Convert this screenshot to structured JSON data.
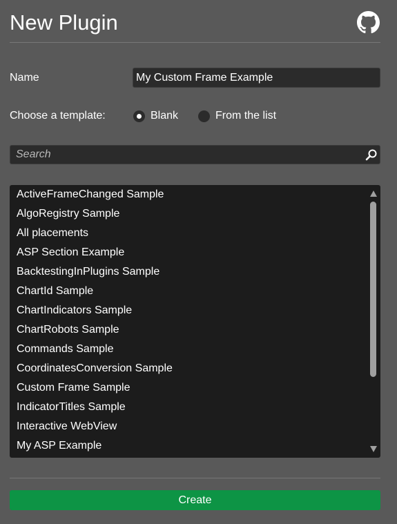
{
  "header": {
    "title": "New Plugin",
    "github_icon": "github-icon"
  },
  "form": {
    "name_label": "Name",
    "name_value": "My Custom Frame Example",
    "template_label": "Choose a template:",
    "template_options": [
      {
        "label": "Blank",
        "selected": true
      },
      {
        "label": "From the list",
        "selected": false
      }
    ]
  },
  "search": {
    "placeholder": "Search",
    "icon": "search-icon"
  },
  "template_list": {
    "items": [
      "ActiveFrameChanged Sample",
      "AlgoRegistry Sample",
      "All placements",
      "ASP Section Example",
      "BacktestingInPlugins Sample",
      "ChartId Sample",
      "ChartIndicators Sample",
      "ChartRobots Sample",
      "Commands Sample",
      "CoordinatesConversion Sample",
      "Custom Frame Sample",
      "IndicatorTitles Sample",
      "Interactive WebView",
      "My ASP Example"
    ],
    "scroll_position": 0
  },
  "footer": {
    "create_label": "Create"
  },
  "colors": {
    "background": "#595959",
    "field": "#2b2b2b",
    "list_background": "#1c1c1c",
    "accent_green": "#0d9445",
    "scrollbar": "#a0a0a0"
  }
}
